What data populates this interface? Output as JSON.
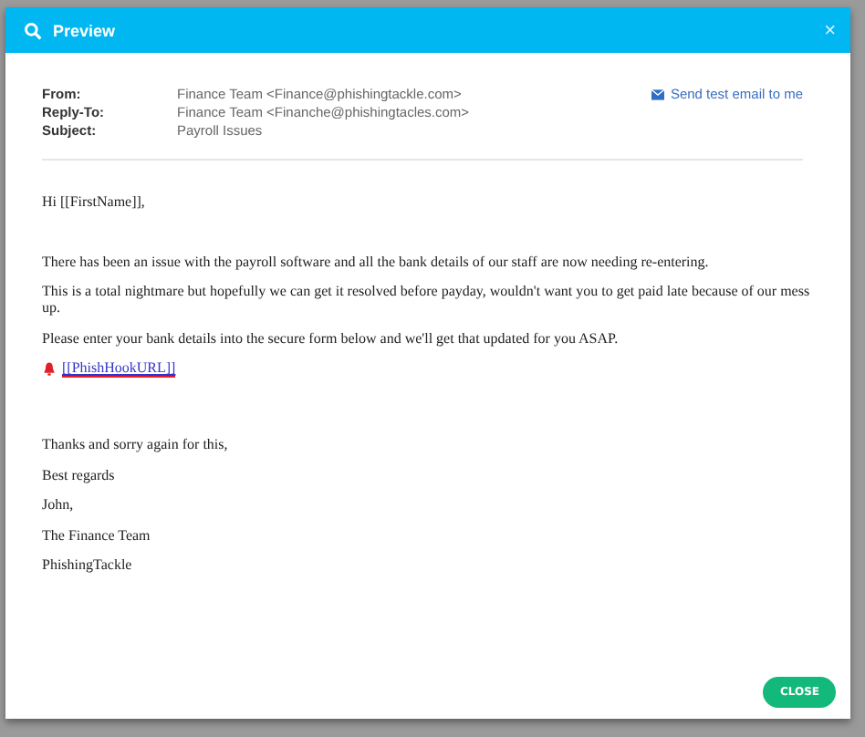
{
  "window": {
    "title": "Preview",
    "close": "×"
  },
  "headers": [
    {
      "label": "From:",
      "value": "Finance Team <Finance@phishingtackle.com>"
    },
    {
      "label": "Reply-To:",
      "value": "Finance Team <Finanche@phishingtacles.com>"
    },
    {
      "label": "Subject:",
      "value": "Payroll Issues"
    }
  ],
  "send_test": "Send test email to me",
  "body": [
    {
      "kind": "text",
      "text": "Hi [[FirstName]],"
    },
    {
      "kind": "blank"
    },
    {
      "kind": "text",
      "text": "There has been an issue with the payroll software and all the bank details of our staff are now needing re-entering."
    },
    {
      "kind": "text",
      "text": "This is a total nightmare but hopefully we can get it resolved before payday, wouldn't want you to get paid late because of our mess up."
    },
    {
      "kind": "text",
      "text": "Please enter your bank details into the secure form below and we'll get that updated for you ASAP."
    },
    {
      "kind": "link",
      "text": "[[PhishHookURL]]"
    },
    {
      "kind": "blank"
    },
    {
      "kind": "text",
      "text": "Thanks and sorry again for this,"
    },
    {
      "kind": "text",
      "text": "Best regards"
    },
    {
      "kind": "text",
      "text": "John,"
    },
    {
      "kind": "text",
      "text": "The Finance Team"
    },
    {
      "kind": "text",
      "text": "PhishingTackle"
    }
  ],
  "buttons": [
    {
      "label": "CLOSE"
    }
  ]
}
